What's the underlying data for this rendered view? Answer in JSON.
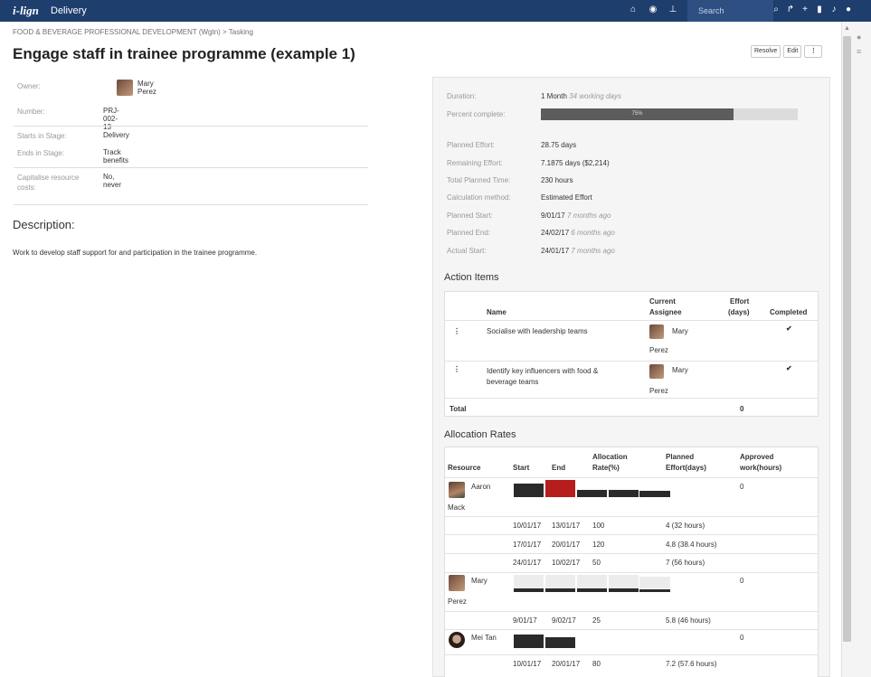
{
  "topbar": {
    "logo": "i-lign",
    "app_name": "Delivery",
    "search_placeholder": "Search"
  },
  "breadcrumb": "FOOD & BEVERAGE PROFESSIONAL DEVELOPMENT (Wgtn) > Tasking",
  "page_title": "Engage staff in trainee programme (example 1)",
  "actions": {
    "resolve": "Resolve",
    "edit": "Edit",
    "more": "⋮"
  },
  "info": {
    "owner_label": "Owner:",
    "owner_value": "Mary Perez",
    "number_label": "Number:",
    "number_value": "PRJ-002-13",
    "starts_label": "Starts in Stage:",
    "starts_value": "Delivery",
    "ends_label": "Ends in Stage:",
    "ends_value": "Track benefits",
    "capitalise_label": "Capitalise resource costs:",
    "capitalise_value": "No, never"
  },
  "description": {
    "title": "Description:",
    "text": "Work to develop staff support for and participation in the trainee programme."
  },
  "details": {
    "duration_label": "Duration:",
    "duration_value": "1 Month",
    "duration_note": "34 working days",
    "percent_label": "Percent complete:",
    "percent_value": "75%",
    "percent_fraction": 0.75,
    "planned_effort_label": "Planned Effort:",
    "planned_effort_value": "28.75 days",
    "remaining_effort_label": "Remaining Effort:",
    "remaining_effort_value": "7.1875 days ($2,214)",
    "total_time_label": "Total Planned Time:",
    "total_time_value": "230 hours",
    "calc_label": "Calculation method:",
    "calc_value": "Estimated Effort",
    "planned_start_label": "Planned Start:",
    "planned_start_value": "9/01/17",
    "planned_start_note": "7 months ago",
    "planned_end_label": "Planned End:",
    "planned_end_value": "24/02/17",
    "planned_end_note": "6 months ago",
    "actual_start_label": "Actual Start:",
    "actual_start_value": "24/01/17",
    "actual_start_note": "7 months ago"
  },
  "action_items": {
    "title": "Action Items",
    "col_name": "Name",
    "col_assignee_1": "Current",
    "col_assignee_2": "Assignee",
    "col_effort_1": "Effort",
    "col_effort_2": "(days)",
    "col_completed": "Completed",
    "rows": [
      {
        "name": "Socialise with leadership teams",
        "name_2": "",
        "assignee_1": "Mary",
        "assignee_2": "Perez",
        "completed": "✔"
      },
      {
        "name": "Identify key influencers with food &",
        "name_2": "beverage teams",
        "assignee_1": "Mary",
        "assignee_2": "Perez",
        "completed": "✔"
      }
    ],
    "total_label": "Total",
    "total_value": "0"
  },
  "allocation": {
    "title": "Allocation Rates",
    "col_resource": "Resource",
    "col_start": "Start",
    "col_end": "End",
    "col_rate_1": "Allocation",
    "col_rate_2": "Rate(%)",
    "col_planned_1": "Planned",
    "col_planned_2": "Effort(days)",
    "col_approved_1": "Approved",
    "col_approved_2": "work(hours)",
    "resources": [
      {
        "name_1": "Aaron",
        "name_2": "Mack",
        "approved": "0",
        "rows": [
          {
            "start": "10/01/17",
            "end": "13/01/17",
            "rate": "100",
            "planned": "4 (32 hours)"
          },
          {
            "start": "17/01/17",
            "end": "20/01/17",
            "rate": "120",
            "planned": "4.8 (38.4 hours)"
          },
          {
            "start": "24/01/17",
            "end": "10/02/17",
            "rate": "50",
            "planned": "7 (56 hours)"
          }
        ]
      },
      {
        "name_1": "Mary",
        "name_2": "Perez",
        "approved": "0",
        "rows": [
          {
            "start": "9/01/17",
            "end": "9/02/17",
            "rate": "25",
            "planned": "5.8 (46 hours)"
          }
        ]
      },
      {
        "name_1": "Mei Tan",
        "name_2": "",
        "approved": "0",
        "rows": [
          {
            "start": "10/01/17",
            "end": "20/01/17",
            "rate": "80",
            "planned": "7.2 (57.6 hours)"
          }
        ]
      }
    ]
  }
}
